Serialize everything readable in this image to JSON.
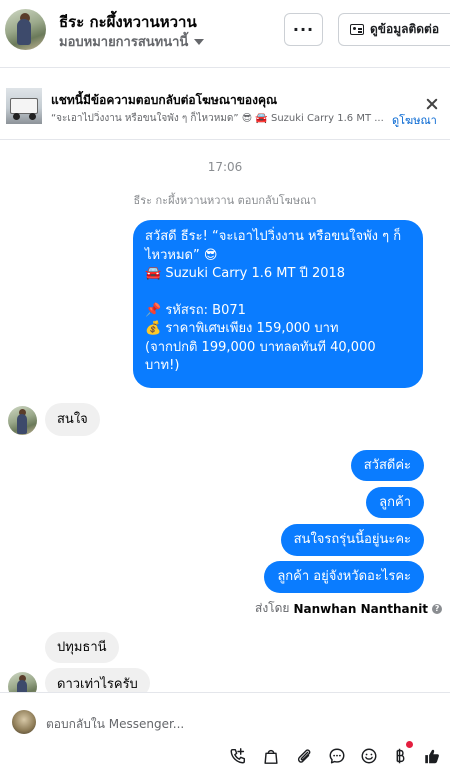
{
  "header": {
    "contact_name": "ธีระ กะผึ้งหวานหวาน",
    "assign_label": "มอบหมายการสนทนานี้",
    "more_label": "···",
    "info_button_label": "ดูข้อมูลติดต่อ"
  },
  "ad_banner": {
    "title": "แชทนี้มีข้อความตอบกลับต่อโฆษณาของคุณ",
    "subtitle": "“จะเอาไปวิ่งงาน หรือขนใจพัง ๆ ก็ไหวหมด” 😎 🚘 Suzuki Carry 1.6 MT ...",
    "link_label": "ดูโฆษณา"
  },
  "chat": {
    "timestamp": "17:06",
    "system_note": "ธีระ กะผึ้งหวานหวาน ตอบกลับโฆษณา",
    "ad_message_lines": [
      "สวัสดี ธีระ! “จะเอาไปวิ่งงาน หรือขนใจพัง ๆ ก็",
      "ไหวหมด” 😎",
      "🚘 Suzuki Carry 1.6 MT ปี 2018",
      "",
      "📌 รหัสรถ: B071",
      "💰 ราคาพิเศษเพียง 159,000 บาท",
      "(จากปกติ 199,000 บาทลดทันที 40,000",
      "บาท!)"
    ],
    "incoming_1": "สนใจ",
    "outgoing_1": "สวัสดีค่ะ",
    "outgoing_2": "ลูกค้า",
    "outgoing_3": "สนใจรถรุ่นนี้อยู่นะคะ",
    "outgoing_4": "ลูกค้า อยู่จังหวัดอะไรคะ",
    "sent_by_prefix": "ส่งโดย",
    "sent_by_name": "Nanwhan Nanthanit",
    "incoming_2": "ปทุมธานี",
    "incoming_3": "ดาวเท่าไรครับ"
  },
  "composer": {
    "placeholder": "ตอบกลับใน Messenger..."
  },
  "icons": [
    "call-add-icon",
    "shopping-bag-icon",
    "paperclip-icon",
    "chat-bubble-icon",
    "emoji-icon",
    "baht-icon",
    "thumbs-up-icon"
  ],
  "colors": {
    "outgoing_bubble": "#0a7cff",
    "incoming_bubble": "#f0f0f0",
    "link": "#0064d1",
    "notification_dot": "#e41e3f"
  }
}
